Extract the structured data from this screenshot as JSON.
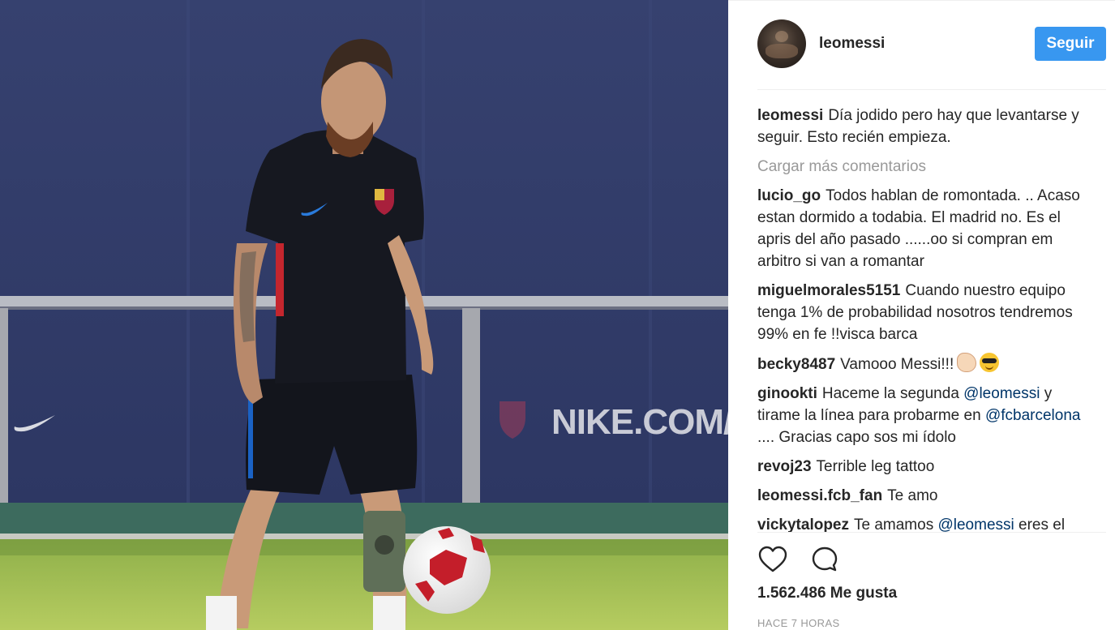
{
  "post": {
    "image_alt": "Lionel Messi training with a football",
    "banner_text": "NIKE.COM/FC"
  },
  "header": {
    "username": "leomessi",
    "follow_label": "Seguir"
  },
  "caption": {
    "user": "leomessi",
    "text": "Día jodido pero hay que levantarse y seguir. Esto recién empieza."
  },
  "load_more": "Cargar más comentarios",
  "comments": [
    {
      "user": "lucio_go",
      "text": "Todos hablan de romontada. .. Acaso estan dormido a todabia. El madrid no. Es el apris del año pasado ......oo si compran em arbitro si van a romantar"
    },
    {
      "user": "miguelmorales5151",
      "text": "Cuando nuestro equipo tenga 1% de probabilidad nosotros tendremos 99% en fe !!visca barca"
    },
    {
      "user": "becky8487",
      "text": "Vamooo Messi!!!"
    },
    {
      "user": "ginookti",
      "text_a": "Haceme la segunda",
      "mention_a": "@leomessi",
      "text_b": "y tirame la línea para probarme en",
      "mention_b": "@fcbarcelona",
      "text_c": ".... Gracias capo sos mi ídolo"
    },
    {
      "user": "revoj23",
      "text": "Terrible leg tattoo"
    },
    {
      "user": "leomessi.fcb_fan",
      "text": "Te amo"
    },
    {
      "user": "vickytalopez",
      "text_a": "Te amamos",
      "mention_a": "@leomessi",
      "text_b": "eres el"
    }
  ],
  "icons": {
    "like": "heart-outline-icon",
    "comment": "speech-bubble-icon",
    "emoji_1": "flexed-biceps-emoji",
    "emoji_2": "sunglasses-face-emoji"
  },
  "likes": "1.562.486 Me gusta",
  "time": "HACE 7 HORAS",
  "colors": {
    "follow_button": "#3897f0",
    "mention": "#003569",
    "muted": "#999999",
    "text": "#262626"
  }
}
